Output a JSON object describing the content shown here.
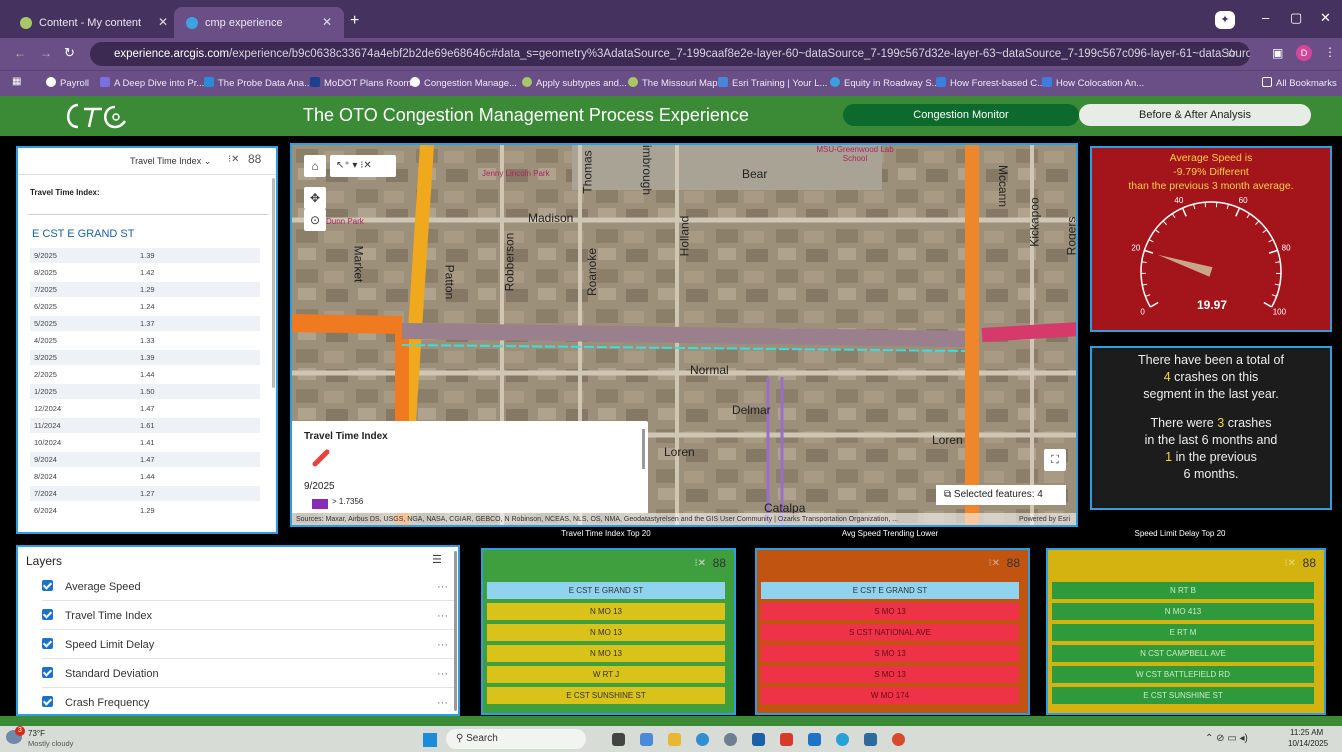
{
  "browser": {
    "tabs": [
      {
        "label": "Content - My content",
        "active": false
      },
      {
        "label": "cmp experience",
        "active": true
      }
    ],
    "url_domain": "experience.arcgis.com",
    "url_rest": "/experience/b9c0638c33674a4ebf2b2de69e68646c#data_s=geometry%3AdataSource_7-199caaf8e2e-layer-60~dataSource_7-199c567d32e-layer-63~dataSource_7-199c567c096-layer-61~dataSource_7-1999c7e5b7c-layer-62%3A%7...",
    "bookmarks": [
      "Payroll",
      "A Deep Dive into Pr...",
      "The Probe Data Ana...",
      "MoDOT Plans Room",
      "Congestion Manage...",
      "Apply subtypes and...",
      "The Missouri Map",
      "Esri Training | Your L...",
      "Equity in Roadway S...",
      "How Forest-based C...",
      "How Colocation An..."
    ],
    "all_bookmarks": "All Bookmarks",
    "profile_initial": "D"
  },
  "app": {
    "title": "The OTO Congestion Management Process Experience",
    "nav_congestion": "Congestion Monitor",
    "nav_before_after": "Before & After Analysis"
  },
  "tti_panel": {
    "dropdown": "Travel Time Index",
    "label": "Travel Time Index:",
    "segment": "E CST E GRAND ST",
    "rows": [
      {
        "month": "9/2025",
        "value": "1.39"
      },
      {
        "month": "8/2025",
        "value": "1.42"
      },
      {
        "month": "7/2025",
        "value": "1.29"
      },
      {
        "month": "6/2025",
        "value": "1.24"
      },
      {
        "month": "5/2025",
        "value": "1.37"
      },
      {
        "month": "4/2025",
        "value": "1.33"
      },
      {
        "month": "3/2025",
        "value": "1.39"
      },
      {
        "month": "2/2025",
        "value": "1.44"
      },
      {
        "month": "1/2025",
        "value": "1.50"
      },
      {
        "month": "12/2024",
        "value": "1.47"
      },
      {
        "month": "11/2024",
        "value": "1.61"
      },
      {
        "month": "10/2024",
        "value": "1.41"
      },
      {
        "month": "9/2024",
        "value": "1.47"
      },
      {
        "month": "8/2024",
        "value": "1.44"
      },
      {
        "month": "7/2024",
        "value": "1.27"
      },
      {
        "month": "6/2024",
        "value": "1.29"
      }
    ]
  },
  "map": {
    "streets": [
      "Bear",
      "Madison",
      "Normal",
      "Delmar",
      "Loren",
      "Loren",
      "Market",
      "Patton",
      "Robberson",
      "Roanoke",
      "Holland",
      "Thomas",
      "Kimbrough",
      "Mccann",
      "Kickapoo",
      "Rogers",
      "Catalpa"
    ],
    "places": [
      "Jenny Lincoln Park",
      "MSU-Greenwood Lab School",
      "Dunn Park"
    ],
    "legend_title": "Travel Time Index",
    "legend_date": "9/2025",
    "legend_value": "> 1.7356",
    "selected": "Selected features: 4",
    "attribution": "Sources: Maxar, Airbus DS, USGS, NGA, NASA, CGIAR, GEBCO, N Robinson, NCEAS, NLS, OS, NMA, Geodatastyrelsen and the GIS User Community | Ozarks Transportation Organization, ...",
    "powered": "Powered by Esri"
  },
  "speed_panel": {
    "line1": "Average Speed is",
    "line2": "-9.79% Different",
    "line3": "than the previous 3 month average.",
    "gauge_value": "19.97",
    "gauge_value_num": 19.97,
    "gauge_min": 0,
    "gauge_max": 100,
    "ticks": [
      "0",
      "20",
      "40",
      "60",
      "80",
      "100"
    ]
  },
  "crash_panel": {
    "t1": "There have been a total of",
    "total": "4",
    "t2": "crashes on this",
    "t3": "segment in the last year.",
    "t4": "There were",
    "six": "3",
    "t5": "crashes",
    "t6": "in the last 6 months and",
    "prev": "1",
    "t7": "in the previous",
    "t8": "6 months."
  },
  "lists": {
    "tti_title": "Travel Time Index Top 20",
    "tti_items": [
      "E CST E GRAND ST",
      "N MO 13",
      "N MO 13",
      "N MO 13",
      "W RT J",
      "E CST SUNSHINE ST"
    ],
    "speed_title": "Avg Speed Trending Lower",
    "speed_items": [
      "E CST E GRAND ST",
      "S MO 13",
      "S CST NATIONAL AVE",
      "S MO 13",
      "S MO 13",
      "W MO 174"
    ],
    "delay_title": "Speed Limit Delay Top 20",
    "delay_items": [
      "N RT B",
      "N MO 413",
      "E RT M",
      "N CST CAMPBELL AVE",
      "W CST BATTLEFIELD RD",
      "E CST SUNSHINE ST"
    ]
  },
  "layers": {
    "title": "Layers",
    "items": [
      "Average Speed",
      "Travel Time Index",
      "Speed Limit Delay",
      "Standard Deviation",
      "Crash Frequency"
    ]
  },
  "taskbar": {
    "weather_temp": "73°F",
    "weather_desc": "Mostly cloudy",
    "weather_badge": "3",
    "search": "Search",
    "time": "11:25 AM",
    "date": "10/14/2025"
  },
  "colors": {
    "green": "#3a8a36",
    "red": "#a4141b",
    "border": "#2d9ee0",
    "yellow": "#d4b20f",
    "list_red": "#ee3348",
    "list_green": "#2f9a3c"
  }
}
